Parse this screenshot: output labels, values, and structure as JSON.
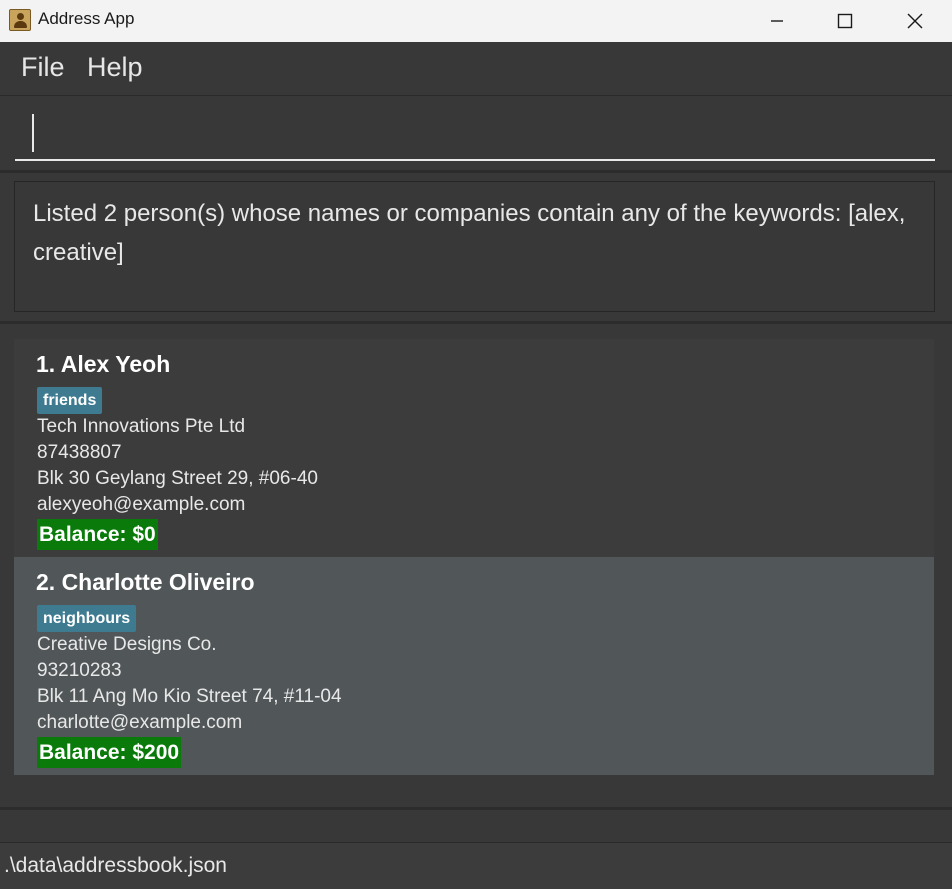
{
  "window": {
    "title": "Address App",
    "icon": "address-book-icon"
  },
  "menu": {
    "file_label": "File",
    "help_label": "Help"
  },
  "command": {
    "value": ""
  },
  "result": {
    "message": "Listed 2 person(s) whose names or companies contain any of the keywords: [alex, creative]"
  },
  "persons": [
    {
      "name": "1. Alex Yeoh",
      "tag": "friends",
      "company": "Tech Innovations Pte Ltd",
      "phone": "87438807",
      "address": "Blk 30 Geylang Street 29, #06-40",
      "email": "alexyeoh@example.com",
      "balance": "Balance: $0"
    },
    {
      "name": "2. Charlotte Oliveiro",
      "tag": "neighbours",
      "company": "Creative Designs Co.",
      "phone": "93210283",
      "address": "Blk 11 Ang Mo Kio Street 74, #11-04",
      "email": "charlotte@example.com",
      "balance": "Balance: $200"
    }
  ],
  "status": {
    "file_path": ".\\data\\addressbook.json"
  },
  "colors": {
    "tag": "#3e7b91",
    "balance": "#0a7a0a",
    "selected_card": "#515658"
  }
}
